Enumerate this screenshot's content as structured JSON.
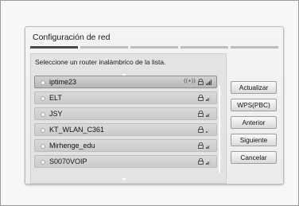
{
  "dialog": {
    "title": "Configuración de red",
    "progress_steps": 5,
    "active_step": 1
  },
  "panel": {
    "instruction": "Seleccione un router inalámbrico de la lista."
  },
  "networks": [
    {
      "ssid": "iptime23",
      "selected": true,
      "wps": true,
      "locked": true,
      "signal": "full"
    },
    {
      "ssid": "ELT",
      "selected": false,
      "wps": false,
      "locked": true,
      "signal": "medium"
    },
    {
      "ssid": "JSY",
      "selected": false,
      "wps": false,
      "locked": true,
      "signal": "medium"
    },
    {
      "ssid": "KT_WLAN_C361",
      "selected": false,
      "wps": false,
      "locked": true,
      "signal": "low"
    },
    {
      "ssid": "Mirhenge_edu",
      "selected": false,
      "wps": false,
      "locked": true,
      "signal": "medium"
    },
    {
      "ssid": "S0070VOIP",
      "selected": false,
      "wps": false,
      "locked": true,
      "signal": "medium"
    }
  ],
  "buttons": {
    "refresh": "Actualizar",
    "wps": "WPS(PBC)",
    "previous": "Anterior",
    "next": "Siguiente",
    "cancel": "Cancelar"
  },
  "colors": {
    "selected_row": "#b8b8b8",
    "row": "#cbcbcb",
    "progress_active": "#4a4a4a"
  }
}
